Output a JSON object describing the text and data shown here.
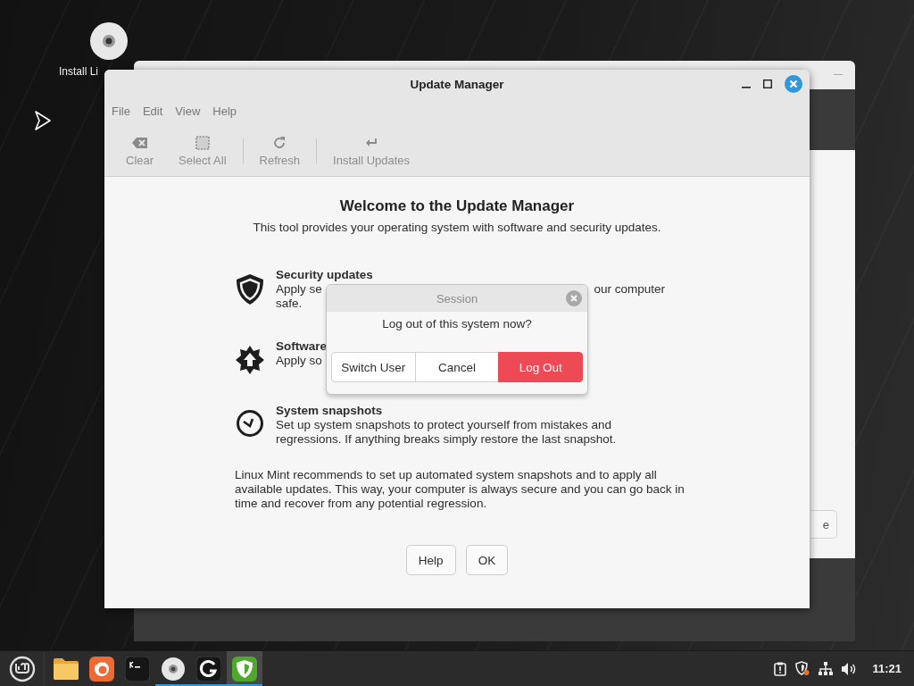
{
  "desktop_icons": [
    {
      "label": "Install Li"
    }
  ],
  "background_window": {
    "button_label": "e"
  },
  "window": {
    "title": "Update Manager",
    "menu": [
      "File",
      "Edit",
      "View",
      "Help"
    ],
    "toolbar": [
      {
        "kind": "clear",
        "label": "Clear",
        "disabled": true
      },
      {
        "kind": "select-all",
        "label": "Select All",
        "disabled": true
      },
      {
        "kind": "refresh",
        "label": "Refresh",
        "disabled": true
      },
      {
        "kind": "install",
        "label": "Install Updates",
        "disabled": true
      }
    ],
    "heading": "Welcome to the Update Manager",
    "subtitle": "This tool provides your operating system with software and security updates.",
    "features": [
      {
        "kind": "shield",
        "title": "Security updates",
        "lines": [
          [
            "Apply se",
            "our computer"
          ],
          [
            "safe."
          ]
        ]
      },
      {
        "kind": "star",
        "title": "Software",
        "lines": [
          [
            "Apply so"
          ]
        ]
      },
      {
        "kind": "clock",
        "title": "System snapshots",
        "lines": [
          [
            "Set up system snapshots to protect yourself from mistakes and"
          ],
          [
            "regressions. If anything breaks simply restore the last snapshot."
          ]
        ]
      }
    ],
    "recommendation": "Linux Mint recommends to set up automated system snapshots and to apply all available updates. This way, your computer is always secure and you can go back in time and recover from any potential regression.",
    "buttons": [
      "Help",
      "OK"
    ]
  },
  "dialog": {
    "title": "Session",
    "message": "Log out of this system now?",
    "buttons": [
      {
        "label": "Switch User",
        "kind": "normal"
      },
      {
        "label": "Cancel",
        "kind": "normal"
      },
      {
        "label": "Log Out",
        "kind": "destructive"
      }
    ]
  },
  "taskbar": {
    "launchers": [
      {
        "kind": "folder",
        "running": false,
        "active": false
      },
      {
        "kind": "browser",
        "running": false,
        "active": false
      },
      {
        "kind": "terminal",
        "running": false,
        "active": false
      },
      {
        "kind": "disc",
        "running": true,
        "active": false
      },
      {
        "kind": "circle-arrow",
        "running": true,
        "active": false
      },
      {
        "kind": "shield",
        "running": true,
        "active": true
      }
    ],
    "clock": "11:21"
  }
}
